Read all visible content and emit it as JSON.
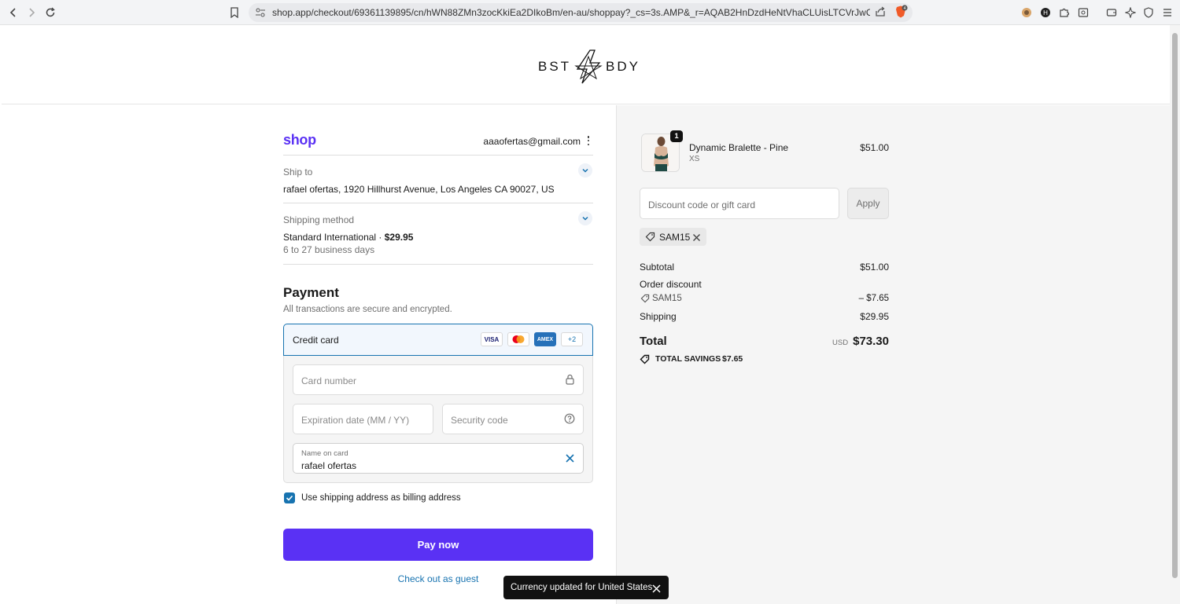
{
  "browser": {
    "url": "shop.app/checkout/69361139895/cn/hWN88ZMn3zocKkiEa2DIkoBm/en-au/shoppay?_cs=3s.AMP&_r=AQAB2HnDzdHeNtVhaCLUisLTCVrJwC9RpKc4Oggv..."
  },
  "header": {
    "logo_text_left": "BST",
    "logo_text_right": "BDY"
  },
  "account": {
    "brand": "shop",
    "email": "aaaofertas@gmail.com"
  },
  "ship_to": {
    "label": "Ship to",
    "value": "rafael ofertas, 1920 Hillhurst Avenue, Los Angeles CA 90027, US"
  },
  "shipping_method": {
    "label": "Shipping method",
    "name": "Standard International · ",
    "price": "$29.95",
    "eta": "6 to 27 business days"
  },
  "payment": {
    "title": "Payment",
    "subtitle": "All transactions are secure and encrypted.",
    "method_label": "Credit card",
    "card_brands": [
      "VISA",
      "MC",
      "AMEX",
      "+2"
    ],
    "card_number_placeholder": "Card number",
    "expiry_placeholder": "Expiration date (MM / YY)",
    "security_placeholder": "Security code",
    "name_label": "Name on card",
    "name_value": "rafael ofertas",
    "billing_checkbox_label": "Use shipping address as billing address",
    "billing_checked": true,
    "pay_button": "Pay now",
    "guest_link": "Check out as guest"
  },
  "order": {
    "product": {
      "name": "Dynamic Bralette - Pine",
      "variant": "XS",
      "price": "$51.00",
      "quantity": "1"
    },
    "discount_placeholder": "Discount code or gift card",
    "apply_label": "Apply",
    "applied_code": "SAM15",
    "subtotal_label": "Subtotal",
    "subtotal_value": "$51.00",
    "order_discount_label": "Order discount",
    "discount_code": "SAM15",
    "discount_value": "– $7.65",
    "shipping_label": "Shipping",
    "shipping_value": "$29.95",
    "total_label": "Total",
    "currency": "USD",
    "total_value": "$73.30",
    "savings_label": "TOTAL SAVINGS",
    "savings_value": "$7.65"
  },
  "toast": {
    "message": "Currency updated for United States"
  },
  "colors": {
    "accent": "#5a31f4",
    "link": "#1773b0"
  }
}
